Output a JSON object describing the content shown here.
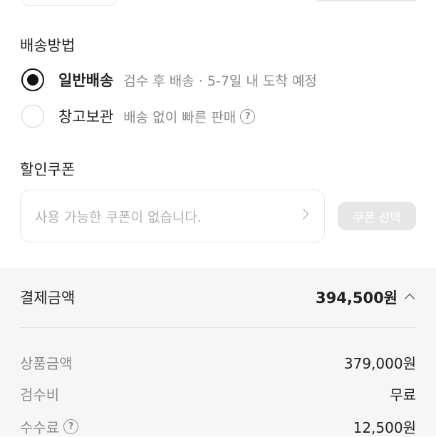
{
  "shipping": {
    "title": "배송방법",
    "options": [
      {
        "label": "일반배송",
        "desc": "검수 후 배송 · 5-7일 내 도착 예정",
        "selected": true
      },
      {
        "label": "창고보관",
        "desc": "배송 없이 빠른 판매",
        "selected": false
      }
    ]
  },
  "coupon": {
    "title": "할인쿠폰",
    "placeholder": "사용 가능한 쿠폰이 없습니다.",
    "select_button": "쿠폰 선택"
  },
  "payment": {
    "title": "결제금액",
    "total": "394,500원",
    "lines": [
      {
        "label": "상품금액",
        "value": "379,000원"
      },
      {
        "label": "검수비",
        "value": "무료"
      },
      {
        "label": "수수료",
        "value": "12,500원"
      }
    ]
  },
  "icons": {
    "help": "?"
  },
  "colors": {
    "text": "#222222",
    "muted": "#8a8a8a",
    "panel_bg": "#f6f6f6",
    "disabled_button": "#e6e6e6"
  }
}
